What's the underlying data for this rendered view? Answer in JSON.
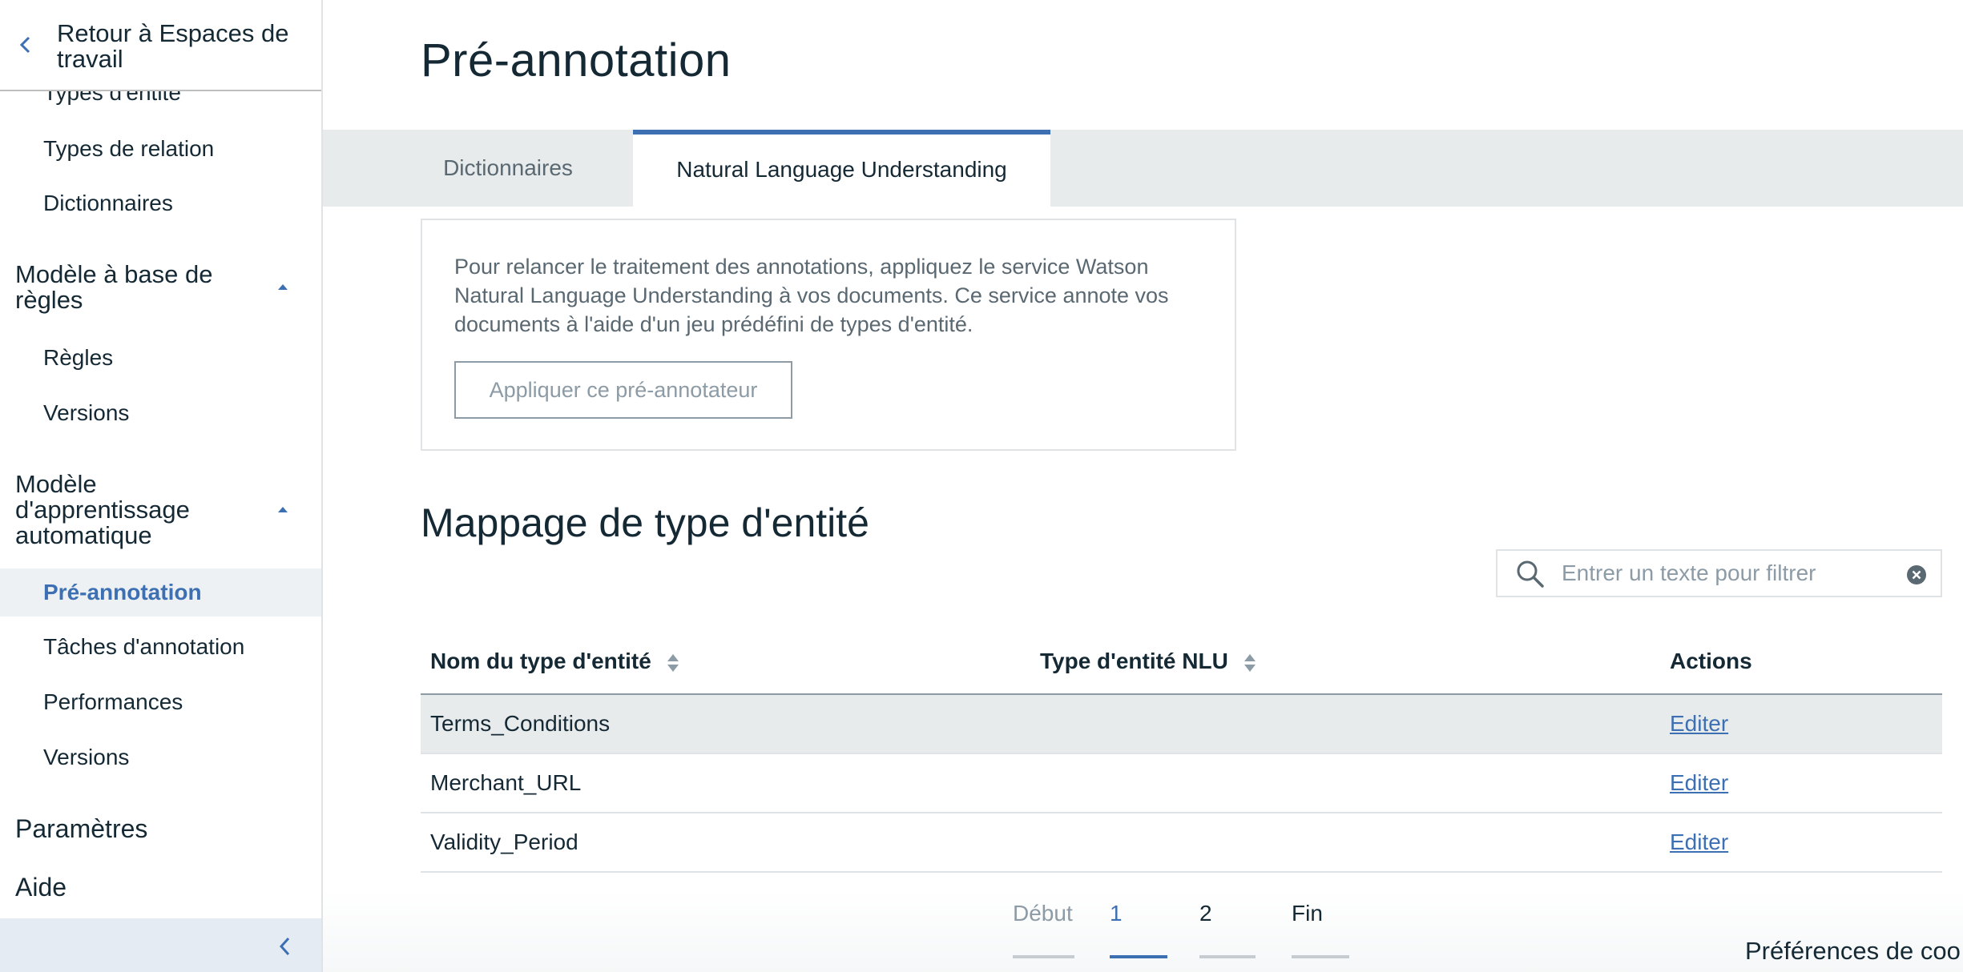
{
  "sidebar": {
    "back_label": "Retour à Espaces de travail",
    "cut_item": "Types d'entité",
    "items_top": [
      "Types de relation",
      "Dictionnaires"
    ],
    "section_rules": "Modèle à base de règles",
    "rules_items": [
      "Règles",
      "Versions"
    ],
    "section_ml": "Modèle d'apprentissage automatique",
    "ml_active": "Pré-annotation",
    "ml_items": [
      "Tâches d'annotation",
      "Performances",
      "Versions"
    ],
    "settings": "Paramètres",
    "help": "Aide"
  },
  "main": {
    "title": "Pré-annotation",
    "tabs": [
      {
        "label": "Dictionnaires",
        "active": false
      },
      {
        "label": "Natural Language Understanding",
        "active": true
      }
    ],
    "info": {
      "text": "Pour relancer le traitement des annotations, appliquez le service Watson Natural Language Understanding à vos documents. Ce service annote vos documents à l'aide d'un jeu prédéfini de types d'entité.",
      "button_label": "Appliquer ce pré-annotateur"
    },
    "mapping_title": "Mappage de type d'entité",
    "filter": {
      "placeholder": "Entrer un texte pour filtrer",
      "value": ""
    },
    "table": {
      "headers": [
        "Nom du type d'entité",
        "Type d'entité NLU",
        "Actions"
      ],
      "rows": [
        {
          "name": "Terms_Conditions",
          "nlu": "",
          "action": "Editer"
        },
        {
          "name": "Merchant_URL",
          "nlu": "",
          "action": "Editer"
        },
        {
          "name": "Validity_Period",
          "nlu": "",
          "action": "Editer"
        }
      ]
    },
    "pagination": {
      "first": "Début",
      "pages": [
        "1",
        "2"
      ],
      "current": "1",
      "last": "Fin"
    },
    "cookie_prefs": "Préférences de coo"
  },
  "colors": {
    "accent": "#3d70b2",
    "text": "#152935",
    "muted": "#5a6872",
    "tab_bg": "#e8ebec"
  },
  "icons": [
    "chevron-left-icon",
    "caret-up-icon",
    "search-icon",
    "clear-icon",
    "sort-icon"
  ]
}
